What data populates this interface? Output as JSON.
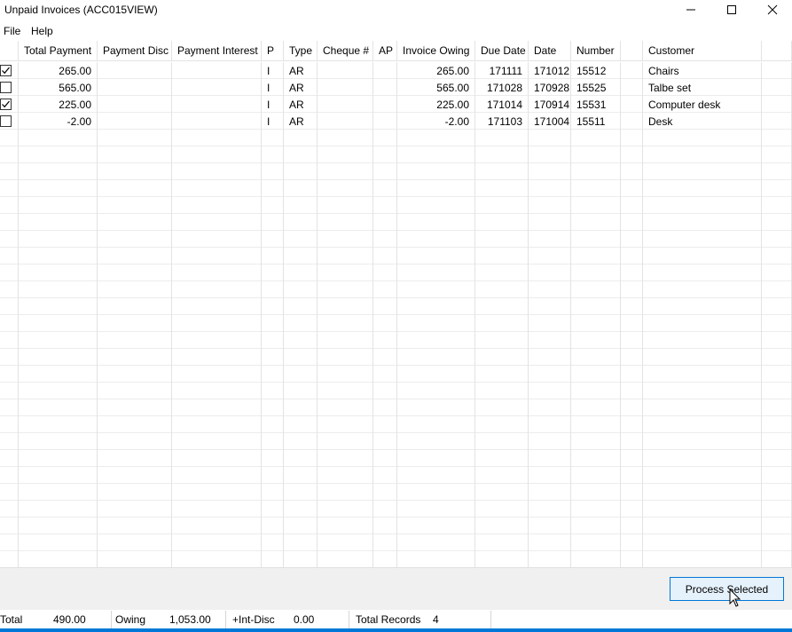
{
  "window": {
    "title": "Unpaid Invoices (ACC015VIEW)"
  },
  "menu": {
    "file": "File",
    "help": "Help"
  },
  "grid": {
    "columns": [
      "",
      "Total Payment",
      "Payment Disc",
      "Payment Interest",
      "P",
      "Type",
      "Cheque #",
      "AP",
      "Invoice Owing",
      "Due Date",
      "Date",
      "Number",
      "",
      "Customer",
      ""
    ],
    "rows": [
      {
        "checked": true,
        "total_payment": "265.00",
        "payment_disc": "",
        "payment_interest": "",
        "p": "I",
        "type": "AR",
        "cheque": "",
        "ap": "",
        "invoice_owing": "265.00",
        "due_date": "171111",
        "date": "171012",
        "number": "15512",
        "customer": "Chairs"
      },
      {
        "checked": false,
        "total_payment": "565.00",
        "payment_disc": "",
        "payment_interest": "",
        "p": "I",
        "type": "AR",
        "cheque": "",
        "ap": "",
        "invoice_owing": "565.00",
        "due_date": "171028",
        "date": "170928",
        "number": "15525",
        "customer": "Talbe set"
      },
      {
        "checked": true,
        "total_payment": "225.00",
        "payment_disc": "",
        "payment_interest": "",
        "p": "I",
        "type": "AR",
        "cheque": "",
        "ap": "",
        "invoice_owing": "225.00",
        "due_date": "171014",
        "date": "170914",
        "number": "15531",
        "customer": "Computer desk"
      },
      {
        "checked": false,
        "total_payment": "-2.00",
        "payment_disc": "",
        "payment_interest": "",
        "p": "I",
        "type": "AR",
        "cheque": "",
        "ap": "",
        "invoice_owing": "-2.00",
        "due_date": "171103",
        "date": "171004",
        "number": "15511",
        "customer": "Desk"
      }
    ]
  },
  "actions": {
    "process_selected": "Process Selected"
  },
  "status": {
    "total_label": "Total",
    "total_value": "490.00",
    "owing_label": "Owing",
    "owing_value": "1,053.00",
    "int_disc_label": "+Int-Disc",
    "int_disc_value": "0.00",
    "records_label": "Total Records",
    "records_value": "4"
  },
  "colors": {
    "accent": "#0078d7",
    "button_bg": "#e5f1fb",
    "panel_bg": "#f0f0f0",
    "gridline": "#e3e3e3"
  }
}
